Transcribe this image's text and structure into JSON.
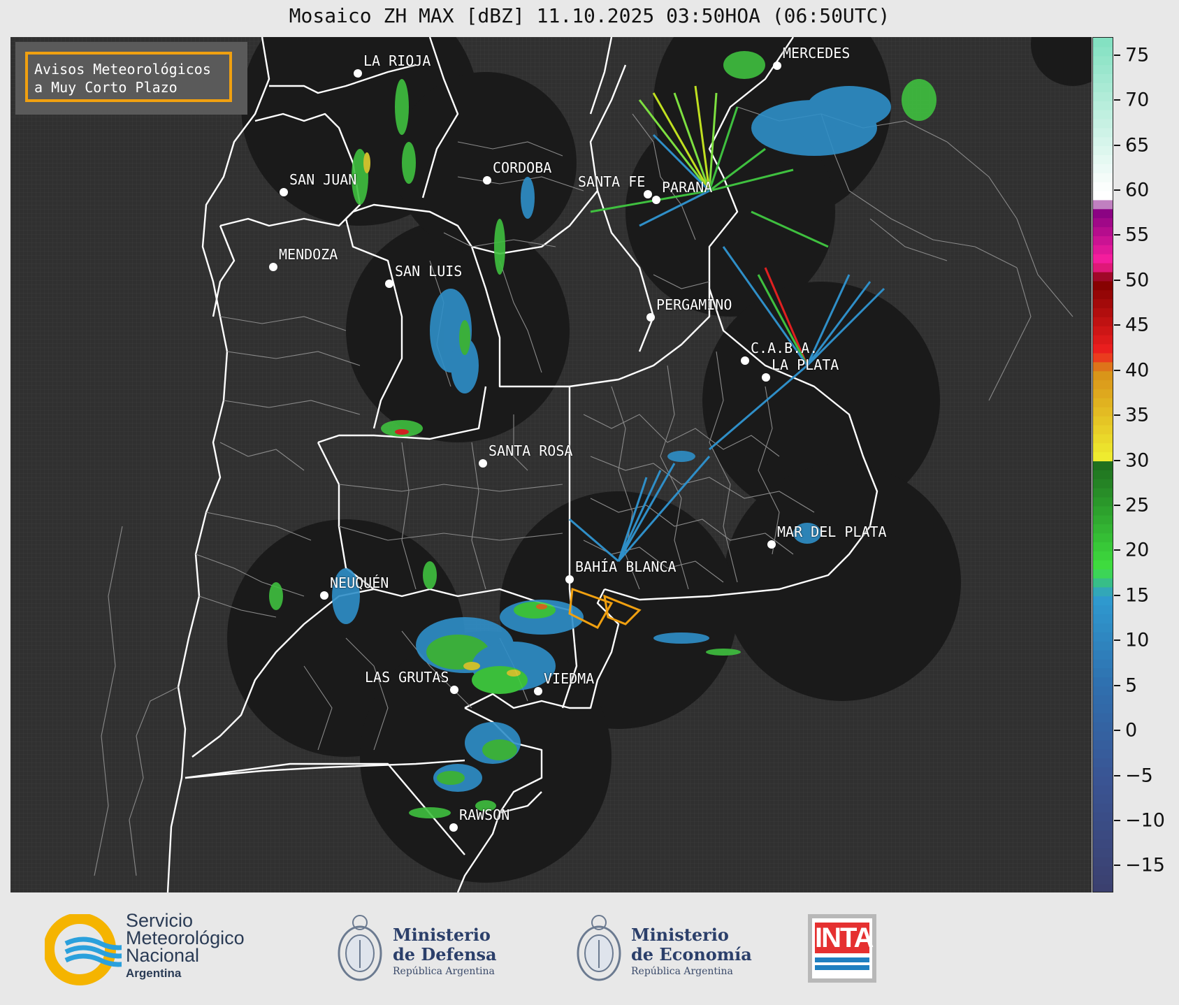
{
  "title": "Mosaico ZH MAX [dBZ] 11.10.2025 03:50HOA (06:50UTC)",
  "notice": {
    "line1": "Avisos Meteorológicos",
    "line2": "a Muy Corto Plazo",
    "color": "#f0a010"
  },
  "cities": [
    {
      "name": "LA RIOJA"
    },
    {
      "name": "SAN JUAN"
    },
    {
      "name": "CORDOBA"
    },
    {
      "name": "SANTA FE"
    },
    {
      "name": "PARANA"
    },
    {
      "name": "MERCEDES"
    },
    {
      "name": "MENDOZA"
    },
    {
      "name": "SAN LUIS"
    },
    {
      "name": "PERGAMINO"
    },
    {
      "name": "C.A.B.A."
    },
    {
      "name": "LA PLATA"
    },
    {
      "name": "SANTA ROSA"
    },
    {
      "name": "NEUQUÉN"
    },
    {
      "name": "BAHÍA BLANCA"
    },
    {
      "name": "MAR DEL PLATA"
    },
    {
      "name": "LAS GRUTAS"
    },
    {
      "name": "VIEDMA"
    },
    {
      "name": "RAWSON"
    }
  ],
  "colorbar": {
    "unit": "dBZ",
    "range": [
      -18,
      77
    ],
    "ticks": [
      "75",
      "70",
      "65",
      "60",
      "55",
      "50",
      "45",
      "40",
      "35",
      "30",
      "25",
      "20",
      "15",
      "10",
      "5",
      "0",
      "−5",
      "−10",
      "−15"
    ],
    "tick_values": [
      75,
      70,
      65,
      60,
      55,
      50,
      45,
      40,
      35,
      30,
      25,
      20,
      15,
      10,
      5,
      0,
      -5,
      -10,
      -15
    ],
    "stops": [
      {
        "v": -18,
        "c": "#3b3f6e"
      },
      {
        "v": -5,
        "c": "#3a5594"
      },
      {
        "v": 5,
        "c": "#2f6fae"
      },
      {
        "v": 15,
        "c": "#2f9bd0"
      },
      {
        "v": 18,
        "c": "#3fe03f"
      },
      {
        "v": 30,
        "c": "#1e6b1e"
      },
      {
        "v": 30.01,
        "c": "#f0f030"
      },
      {
        "v": 40,
        "c": "#d89018"
      },
      {
        "v": 42,
        "c": "#f02020"
      },
      {
        "v": 50,
        "c": "#800000"
      },
      {
        "v": 52,
        "c": "#ff20a0"
      },
      {
        "v": 58,
        "c": "#800080"
      },
      {
        "v": 59,
        "c": "#ffffff"
      },
      {
        "v": 60,
        "c": "#ffffff"
      },
      {
        "v": 77,
        "c": "#80e0c0"
      }
    ]
  },
  "footer": {
    "smn": {
      "line1": "Servicio",
      "line2": "Meteorológico",
      "line3": "Nacional",
      "line4": "Argentina",
      "color_yellow": "#f5b400",
      "color_blue": "#2aa0dc"
    },
    "defensa": {
      "line1": "Ministerio",
      "line2": "de Defensa",
      "line3": "República Argentina"
    },
    "economia": {
      "line1": "Ministerio",
      "line2": "de Economía",
      "line3": "República Argentina"
    },
    "inta": {
      "word": "INTA"
    }
  }
}
